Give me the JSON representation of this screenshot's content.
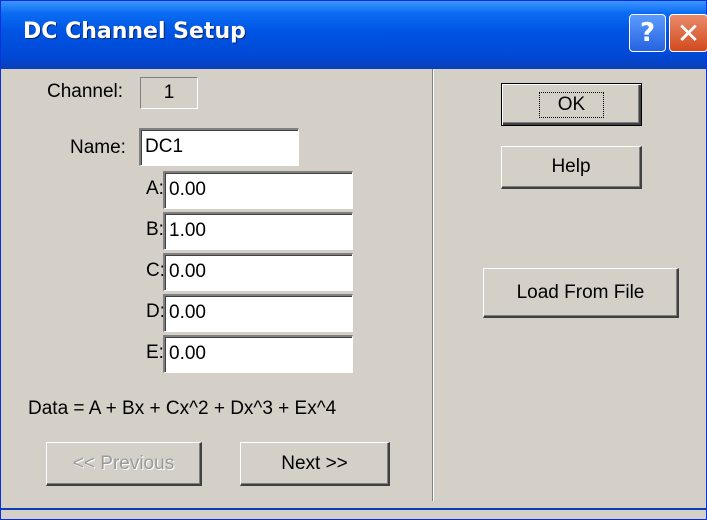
{
  "window": {
    "title": "DC Channel Setup",
    "help_glyph": "?",
    "close_glyph": "✕"
  },
  "channel": {
    "label": "Channel:",
    "value": "1"
  },
  "name": {
    "label": "Name:",
    "value": "DC1"
  },
  "coefficients": [
    {
      "label": "A:",
      "value": "0.00"
    },
    {
      "label": "B:",
      "value": "1.00"
    },
    {
      "label": "C:",
      "value": "0.00"
    },
    {
      "label": "D:",
      "value": "0.00"
    },
    {
      "label": "E:",
      "value": "0.00"
    }
  ],
  "formula": "Data = A + Bx + Cx^2 + Dx^3 + Ex^4",
  "buttons": {
    "previous": "<< Previous",
    "next": "Next >>",
    "ok": "OK",
    "help": "Help",
    "load": "Load From File"
  },
  "colors": {
    "title_bar": "#0054e3",
    "dialog_face": "#d4d0c8",
    "close_button": "#d24a1e"
  },
  "icons": [
    "help-icon",
    "close-icon"
  ]
}
